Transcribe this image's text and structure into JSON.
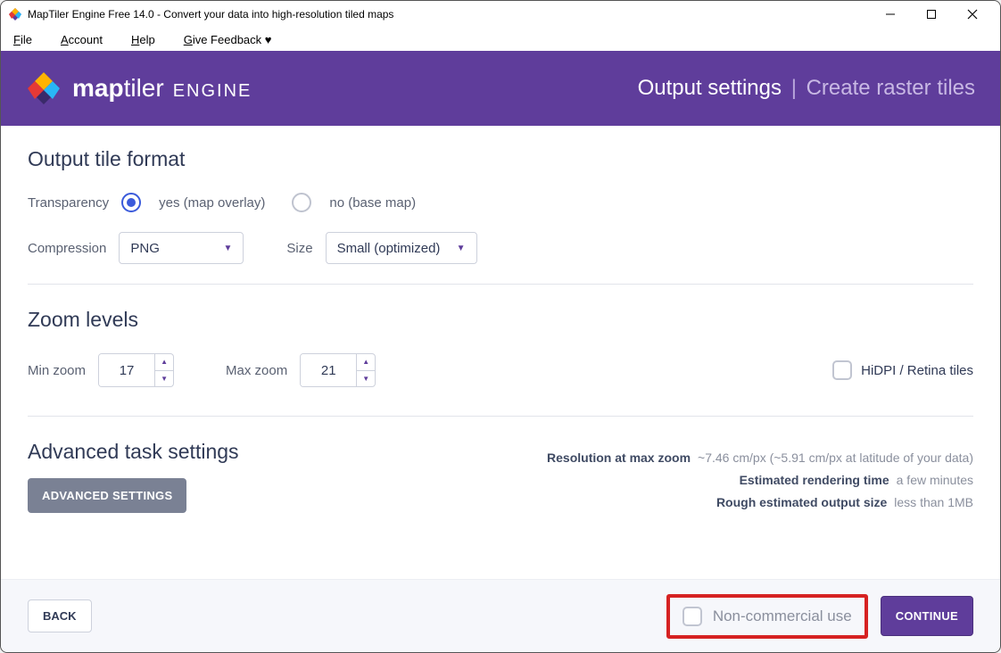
{
  "window": {
    "title": "MapTiler Engine Free 14.0 - Convert your data into high-resolution tiled maps"
  },
  "menu": {
    "file": "File",
    "account": "Account",
    "help": "Help",
    "feedback": "Give Feedback ♥"
  },
  "brand": {
    "map": "map",
    "tiler": "tiler",
    "engine": "ENGINE"
  },
  "header": {
    "title": "Output settings",
    "subtitle": "Create raster tiles"
  },
  "sections": {
    "format_title": "Output tile format",
    "transparency_label": "Transparency",
    "transparency_yes": "yes (map overlay)",
    "transparency_no": "no (base map)",
    "compression_label": "Compression",
    "compression_value": "PNG",
    "size_label": "Size",
    "size_value": "Small (optimized)",
    "zoom_title": "Zoom levels",
    "min_zoom_label": "Min zoom",
    "min_zoom_value": "17",
    "max_zoom_label": "Max zoom",
    "max_zoom_value": "21",
    "hidpi_label": "HiDPI / Retina tiles",
    "advanced_title": "Advanced task settings",
    "advanced_btn": "ADVANCED SETTINGS"
  },
  "stats": {
    "resolution_k": "Resolution at max zoom",
    "resolution_v": "~7.46 cm/px (~5.91 cm/px at latitude of your data)",
    "time_k": "Estimated rendering time",
    "time_v": "a few minutes",
    "size_k": "Rough estimated output size",
    "size_v": "less than 1MB"
  },
  "footer": {
    "back": "BACK",
    "nc_label": "Non-commercial use",
    "continue": "CONTINUE"
  }
}
